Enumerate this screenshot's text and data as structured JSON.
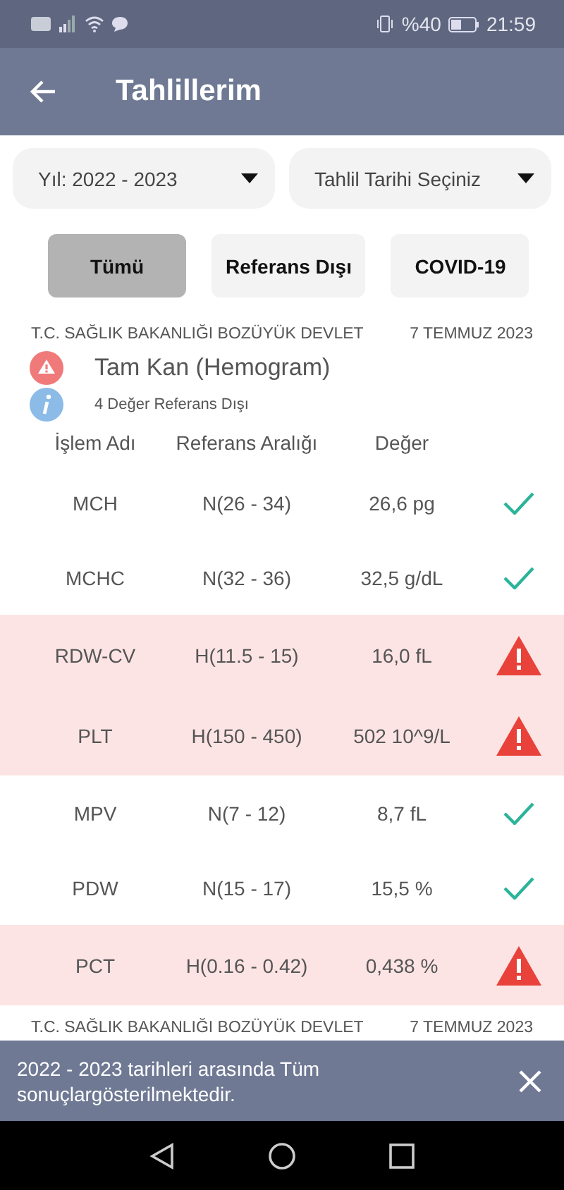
{
  "status_bar": {
    "battery": "%40",
    "time": "21:59"
  },
  "header": {
    "title": "Tahlillerim"
  },
  "filters": [
    {
      "label": "Yıl: 2022 - 2023"
    },
    {
      "label": "Tahlil Tarihi Seçiniz"
    }
  ],
  "tabs": [
    {
      "label": "Tümü",
      "selected": true
    },
    {
      "label": "Referans Dışı",
      "selected": false
    },
    {
      "label": "COVID-19",
      "selected": false
    }
  ],
  "report": {
    "institution": "T.C. SAĞLIK BAKANLIĞI BOZÜYÜK DEVLET",
    "date": "7 TEMMUZ 2023",
    "test_name": "Tam Kan (Hemogram)",
    "summary": "4 Değer Referans Dışı"
  },
  "table": {
    "columns": [
      "İşlem Adı",
      "Referans Aralığı",
      "Değer"
    ],
    "rows": [
      {
        "name": "MCH",
        "range": "N(26 - 34)",
        "value": "26,6 pg",
        "kind": "normal"
      },
      {
        "name": "MCHC",
        "range": "N(32 - 36)",
        "value": "32,5 g/dL",
        "kind": "normal"
      },
      {
        "name": "RDW-CV",
        "range": "H(11.5 - 15)",
        "value": "16,0 fL",
        "kind": "out"
      },
      {
        "name": "PLT",
        "range": "H(150 - 450)",
        "value": "502 10^9/L",
        "kind": "out"
      },
      {
        "name": "MPV",
        "range": "N(7 - 12)",
        "value": "8,7 fL",
        "kind": "normal"
      },
      {
        "name": "PDW",
        "range": "N(15 - 17)",
        "value": "15,5 %",
        "kind": "normal"
      },
      {
        "name": "PCT",
        "range": "H(0.16 - 0.42)",
        "value": "0,438 %",
        "kind": "out"
      }
    ]
  },
  "next_report": {
    "institution": "T.C. SAĞLIK BAKANLIĞI BOZÜYÜK DEVLET",
    "date": "7 TEMMUZ 2023"
  },
  "snackbar": {
    "message": "2022 - 2023 tarihleri arasında Tüm sonuçlargösterilmektedir."
  }
}
